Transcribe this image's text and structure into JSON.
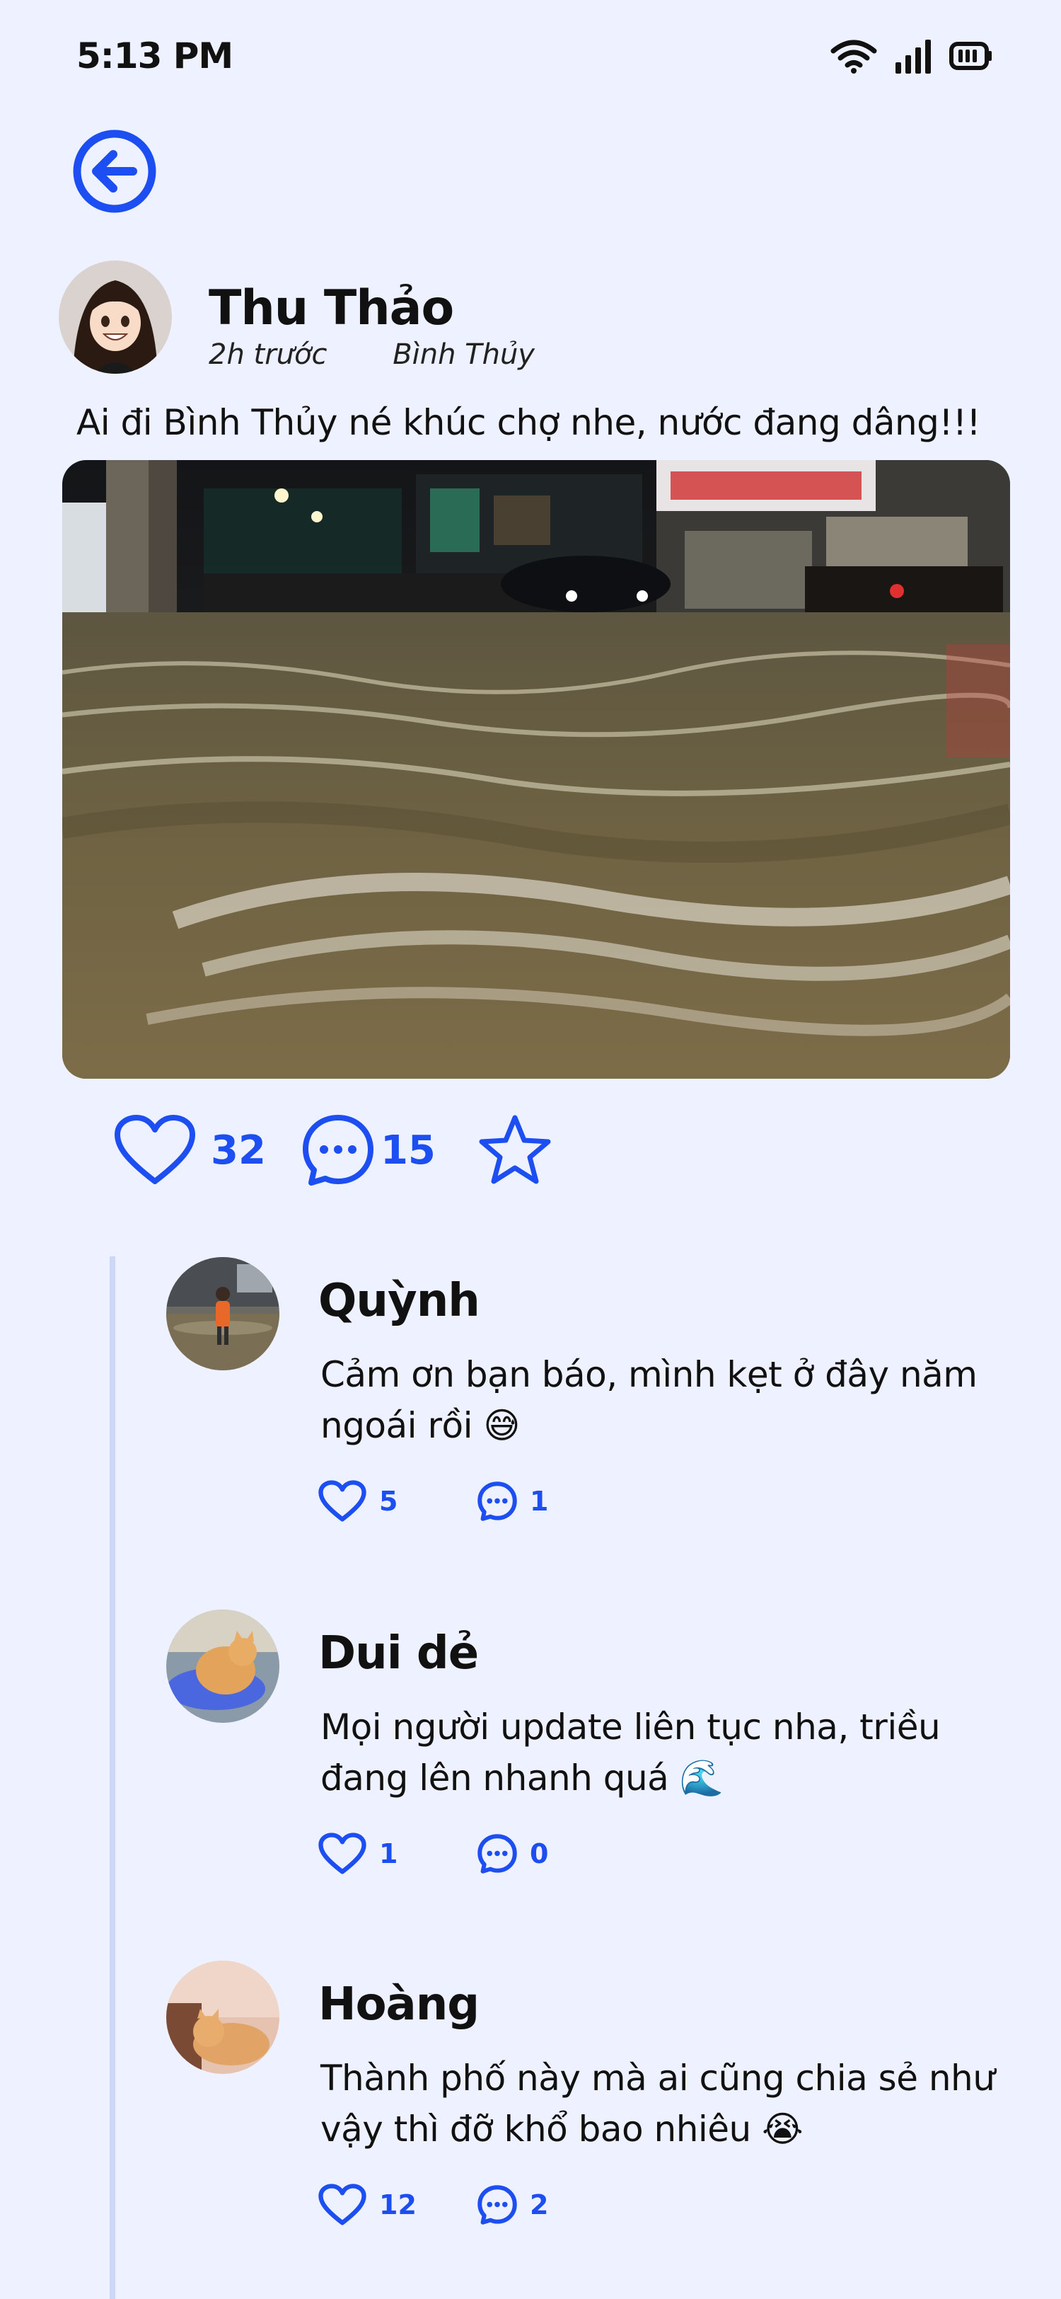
{
  "status_bar": {
    "time": "5:13 PM",
    "icons": [
      "wifi-icon",
      "signal-icon",
      "battery-icon"
    ]
  },
  "back_button": {
    "icon": "arrow-left-circle-icon"
  },
  "post": {
    "author": "Thu Thảo",
    "time_ago": "2h trước",
    "location": "Bình Thủy",
    "text": "Ai đi Bình Thủy né khúc chợ nhe, nước đang dâng!!!",
    "likes": "32",
    "comments": "15",
    "icons": {
      "like": "heart-icon",
      "comment": "chat-bubble-icon",
      "save": "star-icon"
    }
  },
  "comments": [
    {
      "name": "Quỳnh",
      "text": "Cảm ơn bạn báo, mình kẹt ở đây năm ngoái rồi 😅",
      "likes": "5",
      "replies": "1"
    },
    {
      "name": "Dui dẻ",
      "text": "Mọi người update liên tục nha, triều đang lên nhanh quá 🌊",
      "likes": "1",
      "replies": "0"
    },
    {
      "name": "Hoàng",
      "text": "Thành phố này mà ai cũng chia sẻ như vậy thì đỡ khổ bao nhiêu 😭",
      "likes": "12",
      "replies": "2"
    }
  ],
  "colors": {
    "accent": "#1c4ef2",
    "background": "#eef1ff",
    "thread_line": "#cdd7f8"
  }
}
